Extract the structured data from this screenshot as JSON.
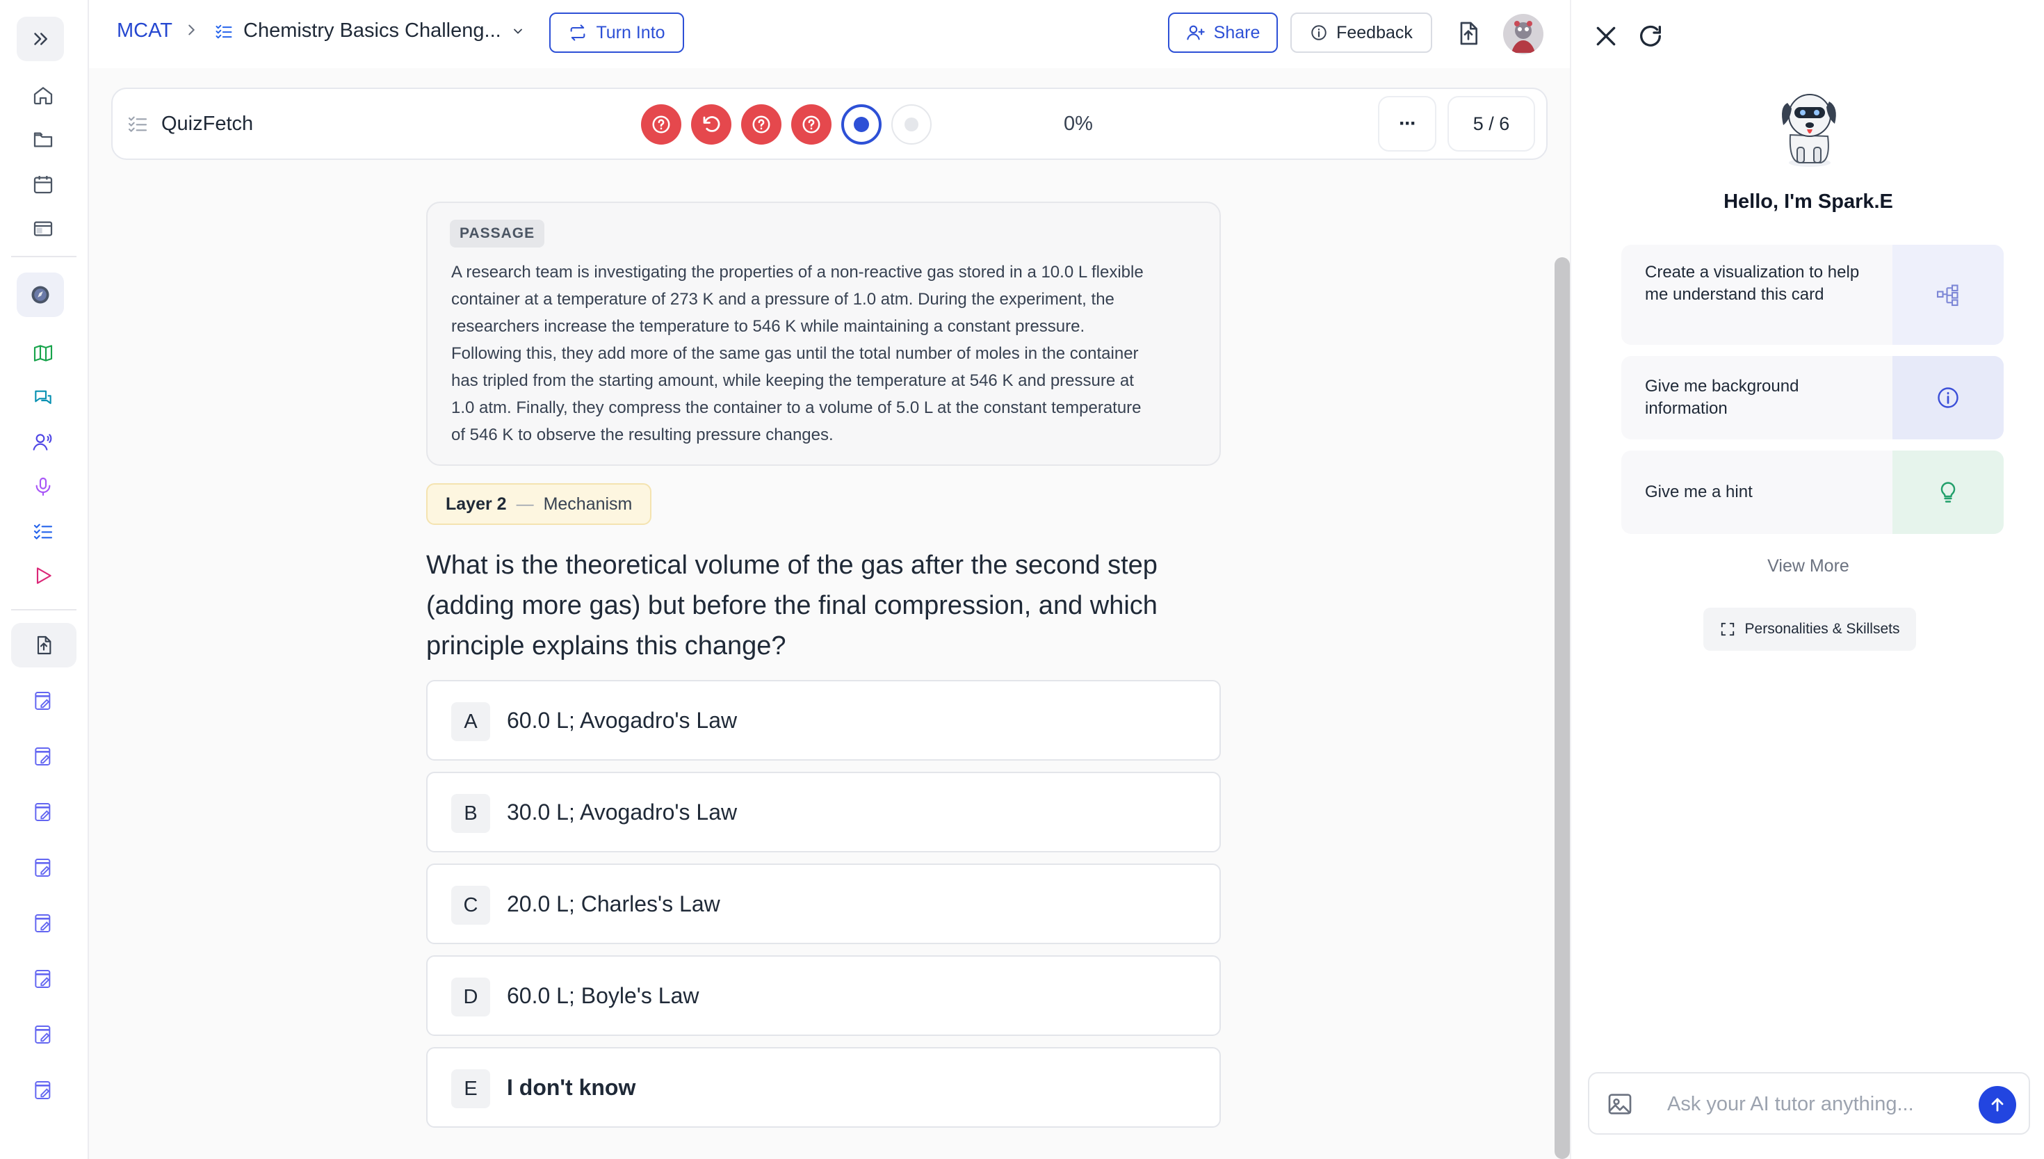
{
  "breadcrumb": {
    "home": "MCAT",
    "title": "Chemistry Basics Challeng..."
  },
  "toolbar": {
    "turn_into": "Turn Into",
    "share": "Share",
    "feedback": "Feedback"
  },
  "quiz": {
    "name": "QuizFetch",
    "progress_text": "0%",
    "counter": "5 / 6",
    "more": "···"
  },
  "passage": {
    "tag": "PASSAGE",
    "lines": [
      "A research team is investigating the properties of a non-reactive gas stored in a 10.0 L flexible",
      "container at a temperature of 273 K and a pressure of 1.0 atm. During the experiment, the",
      "researchers increase the temperature to 546 K while maintaining a constant pressure.",
      "Following this, they add more of the same gas until the total number of moles in the container",
      "has tripled from the starting amount, while keeping the temperature at 546 K and pressure at",
      "1.0 atm. Finally, they compress the container to a volume of 5.0 L at the constant temperature",
      "of 546 K to observe the resulting pressure changes."
    ]
  },
  "layer": {
    "label": "Layer 2",
    "dash": "—",
    "kind": "Mechanism"
  },
  "question": "What is the theoretical volume of the gas after the second step (adding more gas) but before the final compression, and which principle explains this change?",
  "choices": [
    {
      "letter": "A",
      "text": "60.0 L; Avogadro's Law"
    },
    {
      "letter": "B",
      "text": "30.0 L; Avogadro's Law"
    },
    {
      "letter": "C",
      "text": "20.0 L; Charles's Law"
    },
    {
      "letter": "D",
      "text": "60.0 L; Boyle's Law"
    },
    {
      "letter": "E",
      "text": "I don't know"
    }
  ],
  "assistant": {
    "greeting": "Hello, I'm Spark.E",
    "suggestions": [
      {
        "text": "Create a visualization to help me understand this card",
        "icon": "diagram-icon",
        "color": "#eef0fb"
      },
      {
        "text": "Give me background information",
        "icon": "info-icon",
        "color": "#e7eaf9"
      },
      {
        "text": "Give me a hint",
        "icon": "lightbulb-icon",
        "color": "#e6f4ec"
      }
    ],
    "view_more": "View More",
    "personalities": "Personalities & Skillsets",
    "input_placeholder": "Ask your AI tutor anything..."
  },
  "colors": {
    "accent": "#2d50d6",
    "wrong": "#e5484d",
    "send": "#2245e0"
  }
}
